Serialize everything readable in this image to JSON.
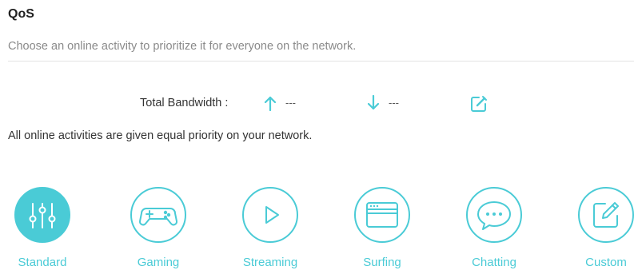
{
  "header": {
    "title": "QoS",
    "subtitle": "Choose an online activity to prioritize it for everyone on the network."
  },
  "bandwidth": {
    "label": "Total Bandwidth :",
    "upload_value": "---",
    "download_value": "---",
    "upload_icon": "arrow-up-icon",
    "download_icon": "arrow-down-icon",
    "edit_icon": "edit-icon"
  },
  "priority_message": "All online activities are given equal priority on your network.",
  "activities": [
    {
      "label": "Standard",
      "icon": "equalizer-icon",
      "selected": true
    },
    {
      "label": "Gaming",
      "icon": "gamepad-icon",
      "selected": false
    },
    {
      "label": "Streaming",
      "icon": "play-icon",
      "selected": false
    },
    {
      "label": "Surfing",
      "icon": "browser-window-icon",
      "selected": false
    },
    {
      "label": "Chatting",
      "icon": "chat-bubble-icon",
      "selected": false
    },
    {
      "label": "Custom",
      "icon": "edit-square-icon",
      "selected": false
    }
  ],
  "colors": {
    "accent": "#4acbd6",
    "text": "#333333",
    "muted": "#8a8a8a",
    "divider": "#e3e3e3"
  }
}
